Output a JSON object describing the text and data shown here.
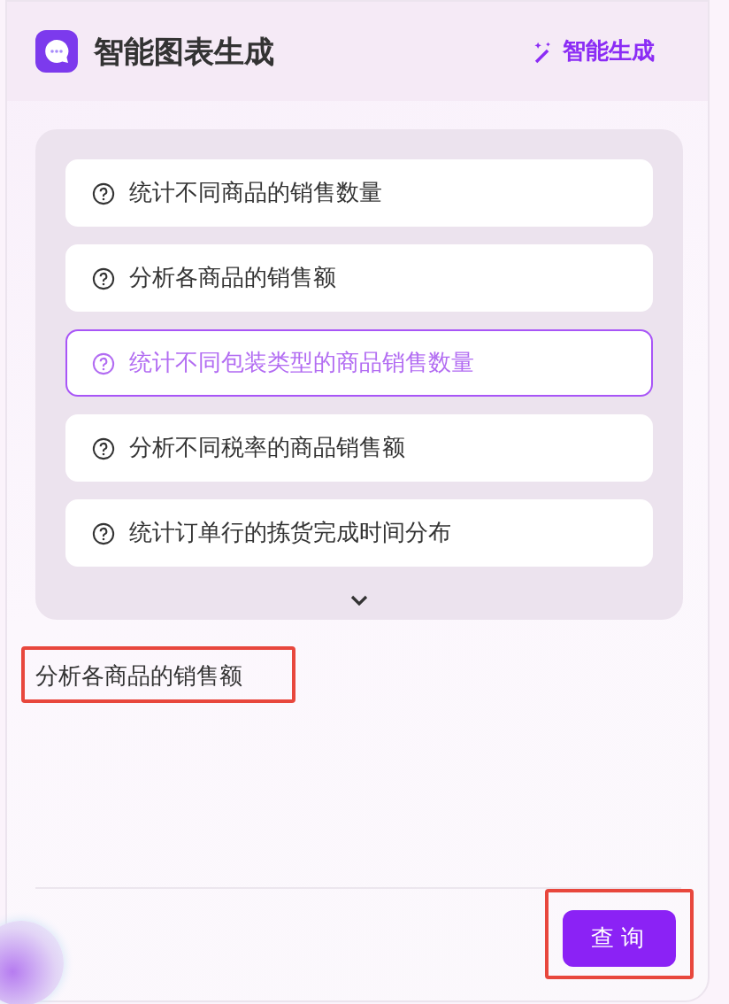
{
  "header": {
    "title": "智能图表生成",
    "action": "智能生成"
  },
  "suggestions": [
    {
      "text": "统计不同商品的销售数量",
      "selected": false
    },
    {
      "text": "分析各商品的销售额",
      "selected": false
    },
    {
      "text": "统计不同包装类型的商品销售数量",
      "selected": true
    },
    {
      "text": "分析不同税率的商品销售额",
      "selected": false
    },
    {
      "text": "统计订单行的拣货完成时间分布",
      "selected": false
    }
  ],
  "query": {
    "value": "分析各商品的销售额",
    "highlighted": true
  },
  "submit": {
    "label": "查询",
    "highlighted": true
  }
}
